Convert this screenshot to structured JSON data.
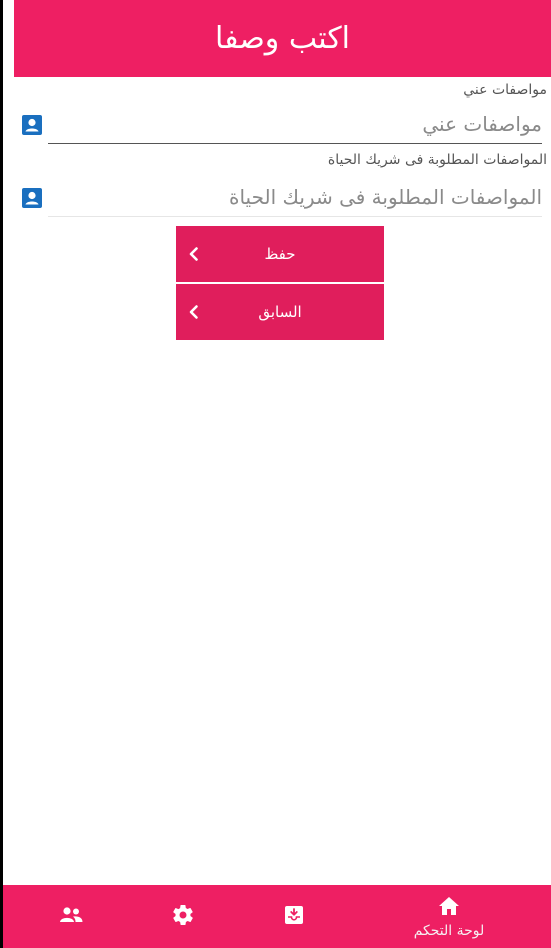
{
  "header": {
    "title": "اكتب وصفا"
  },
  "form": {
    "about_me": {
      "label": "مواصفات عني",
      "placeholder": "مواصفات عني",
      "icon": "contact-card-icon"
    },
    "partner": {
      "label": "المواصفات المطلوبة فى شريك الحياة",
      "placeholder": "المواصفات المطلوبة فى شريك الحياة",
      "icon": "contact-card-icon"
    }
  },
  "buttons": {
    "save_label": "حفظ",
    "previous_label": "السابق"
  },
  "bottom_nav": {
    "dashboard_label": "لوحة التحكم",
    "icons": [
      "people-icon",
      "gear-icon",
      "inbox-icon",
      "home-icon"
    ]
  },
  "colors": {
    "primary": "#ee1f63",
    "button": "#e01e5c",
    "icon_blue": "#1a6fbf"
  }
}
